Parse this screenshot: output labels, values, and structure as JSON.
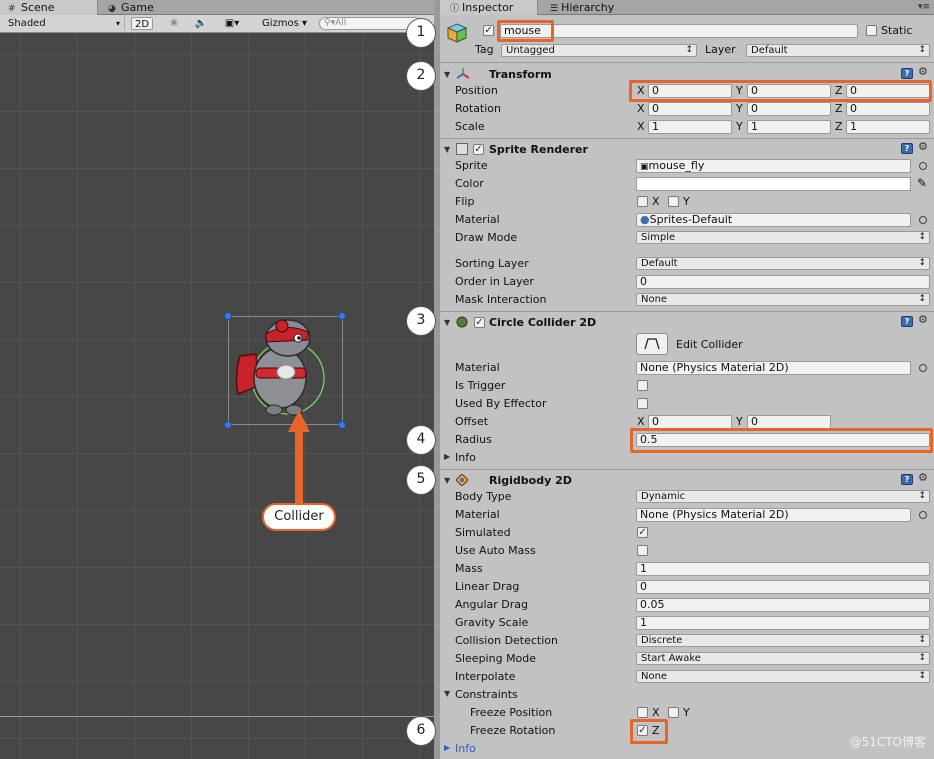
{
  "scene": {
    "tabs": [
      {
        "label": "Scene",
        "icon": "hash-icon"
      },
      {
        "label": "Game",
        "icon": "pacman-icon"
      }
    ],
    "toolbar": {
      "shading": "Shaded",
      "mode_2d": "2D",
      "gizmos": "Gizmos",
      "search_placeholder": "All"
    },
    "callout": "Collider"
  },
  "inspector": {
    "tabs": [
      {
        "label": "Inspector",
        "icon": "info-icon"
      },
      {
        "label": "Hierarchy",
        "icon": "list-icon"
      }
    ],
    "object": {
      "name": "mouse",
      "active": true,
      "static_label": "Static",
      "static": false,
      "tag_label": "Tag",
      "tag": "Untagged",
      "layer_label": "Layer",
      "layer": "Default"
    },
    "transform": {
      "title": "Transform",
      "position_label": "Position",
      "rotation_label": "Rotation",
      "scale_label": "Scale",
      "position": {
        "x": "0",
        "y": "0",
        "z": "0"
      },
      "rotation": {
        "x": "0",
        "y": "0",
        "z": "0"
      },
      "scale": {
        "x": "1",
        "y": "1",
        "z": "1"
      }
    },
    "sprite_renderer": {
      "title": "Sprite Renderer",
      "sprite_label": "Sprite",
      "sprite": "mouse_fly",
      "color_label": "Color",
      "flip_label": "Flip",
      "flip_x": "X",
      "flip_y": "Y",
      "material_label": "Material",
      "material": "Sprites-Default",
      "draw_mode_label": "Draw Mode",
      "draw_mode": "Simple",
      "sorting_layer_label": "Sorting Layer",
      "sorting_layer": "Default",
      "order_label": "Order in Layer",
      "order": "0",
      "mask_label": "Mask Interaction",
      "mask": "None"
    },
    "circle_collider": {
      "title": "Circle Collider 2D",
      "edit_label": "Edit Collider",
      "material_label": "Material",
      "material": "None (Physics Material 2D)",
      "is_trigger_label": "Is Trigger",
      "effector_label": "Used By Effector",
      "offset_label": "Offset",
      "offset": {
        "x": "0",
        "y": "0"
      },
      "radius_label": "Radius",
      "radius": "0.5",
      "info_label": "Info"
    },
    "rigidbody": {
      "title": "Rigidbody 2D",
      "body_type_label": "Body Type",
      "body_type": "Dynamic",
      "material_label": "Material",
      "material": "None (Physics Material 2D)",
      "simulated_label": "Simulated",
      "auto_mass_label": "Use Auto Mass",
      "mass_label": "Mass",
      "mass": "1",
      "linear_drag_label": "Linear Drag",
      "linear_drag": "0",
      "angular_drag_label": "Angular Drag",
      "angular_drag": "0.05",
      "gravity_label": "Gravity Scale",
      "gravity": "1",
      "collision_label": "Collision Detection",
      "collision": "Discrete",
      "sleeping_label": "Sleeping Mode",
      "sleeping": "Start Awake",
      "interpolate_label": "Interpolate",
      "interpolate": "None",
      "constraints_label": "Constraints",
      "freeze_pos_label": "Freeze Position",
      "freeze_rot_label": "Freeze Rotation",
      "axis_x": "X",
      "axis_y": "Y",
      "axis_z": "Z",
      "info_label": "Info"
    },
    "badges": [
      "1",
      "2",
      "3",
      "4",
      "5",
      "6"
    ]
  },
  "axis": {
    "x": "X",
    "y": "Y",
    "z": "Z"
  },
  "watermark": "@51CTO博客",
  "colors": {
    "highlight": "#e8642b",
    "selection_handle": "#3b7bdd",
    "help": "#3d6cb0"
  }
}
